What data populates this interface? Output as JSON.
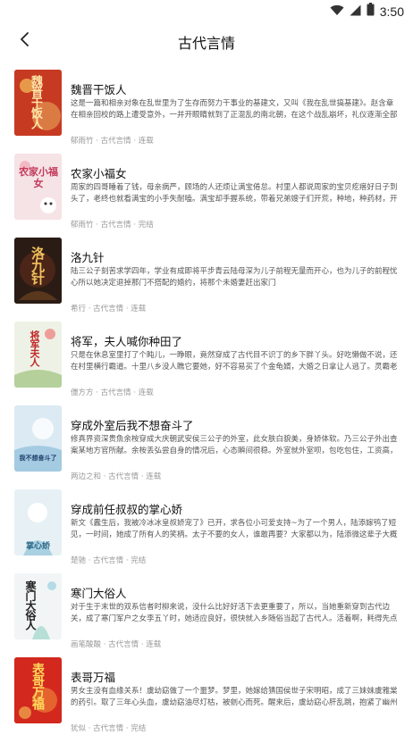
{
  "status": {
    "time": "3:50"
  },
  "header": {
    "title": "古代言情"
  },
  "books": [
    {
      "title": "魏晋干饭人",
      "desc": "这是一篇和相亲对象在乱世里为了生存而努力干事业的基建文，又叫《我在乱世搞基建》。赵含章在相亲回校的路上遭受意外，一并开眼睛就到了正混乱的南北朝，在这个战乱崩坏，礼仪逐渐全部塌掉的…",
      "author": "郁雨竹",
      "genre": "古代言情",
      "status": "连载",
      "cover_bg": "#c73a22",
      "cover_text": "魏晋干饭人"
    },
    {
      "title": "农家小福女",
      "desc": "周家的四哥睡着了钱，母亲病严，顾场的人还烦让满宝倦怠。村里人都说周家的宝贝疙瘩好日子到头了，老终也就看满宝的小手失耐嗑。满宝却手握系统，带着兄弟嫂子们开荒，种地，种药材，开铺子…",
      "author": "郁雨竹",
      "genre": "古代言情",
      "status": "完结",
      "cover_bg": "#f6e3e6",
      "cover_text": "农家小福女"
    },
    {
      "title": "洛九针",
      "desc": "陆三公子刻苦求学四年，学业有成即将平步青云陆母深为儿子前程无量而开心，也为儿子的前程忧心所以她决定退掉那门不搭配的婚约，将那个未婚妻赶出家门",
      "author": "希行",
      "genre": "古代言情",
      "status": "连载",
      "cover_bg": "#2a1c15",
      "cover_text": "洛九针"
    },
    {
      "title": "将军，夫人喊你种田了",
      "desc": "只是在休息室里打了个盹儿，一睁眼，竟然穿成了古代目不识丁的乡下胖丫头。好吃懒做不说，还在村里横行霸道。十里八乡没人瞧它要她，好不容易买了个金龟婿，大婚之日拿让人逃了。灵霸老婆一…",
      "author": "僵方方",
      "genre": "古代言情",
      "status": "连载",
      "cover_bg": "#eef2e6",
      "cover_text": "将军夫人"
    },
    {
      "title": "穿成外室后我不想奋斗了",
      "desc": "修真界资深贵魚余桉穿成大庆朝武安侯三公子的外室，此女肤白貌美，身娇体软。乃三公子外出查案某地方官所献。余桉丢弘尝自身的情况后，心态瞬间很稳。外室就外室呗，包吃包住，工资高，要求少…",
      "author": "两边之和",
      "genre": "古代言情",
      "status": "连载",
      "cover_bg": "#dbeaf3",
      "cover_text": "我不想奋斗了"
    },
    {
      "title": "穿成前任叔叔的掌心娇",
      "desc": "新文《蠹生后，我被冷冰冰皇叔娇宠了》已开，求各位小可爱支持~为了一个男人，陆添嫁鸮了短见，一时间，她成了所有人的笑柄。太子不要的女人，谁敢再要？大家都以为，陆添微这辈子大概只能当…",
      "author": "楚驰",
      "genre": "古代言情",
      "status": "完结",
      "cover_bg": "#e7f1f5",
      "cover_text": "掌心娇"
    },
    {
      "title": "寒门大俗人",
      "desc": "对于生于末世的双系信者时柳来说，没什么比好好活下去更重要了，所以，当她重新穿到古代边关，成了寒门军户之女李五丫时，她适应良好，很快就入乡随俗当起了古代人。活着啊，耗得先点追求。衣…",
      "author": "画笔酸酸",
      "genre": "古代言情",
      "status": "连载",
      "cover_bg": "#f2f5f6",
      "cover_text": "寒门大俗人"
    },
    {
      "title": "表哥万福",
      "desc": "男女主没有血缘关系！虞幼窈做了一个噩梦。梦里，她嫁给猜国侯世子宋明昭，成了三妹妹虞雅棠的药引。取了三年心头血，虞幼窈油尽灯枯，被剜心而死。醒来后，虞幼窈心肝乱跳，抱紧了幽州来的…",
      "author": "犹似",
      "genre": "古代言情",
      "status": "完结",
      "cover_bg": "#d2281d",
      "cover_text": "表哥万福"
    }
  ]
}
